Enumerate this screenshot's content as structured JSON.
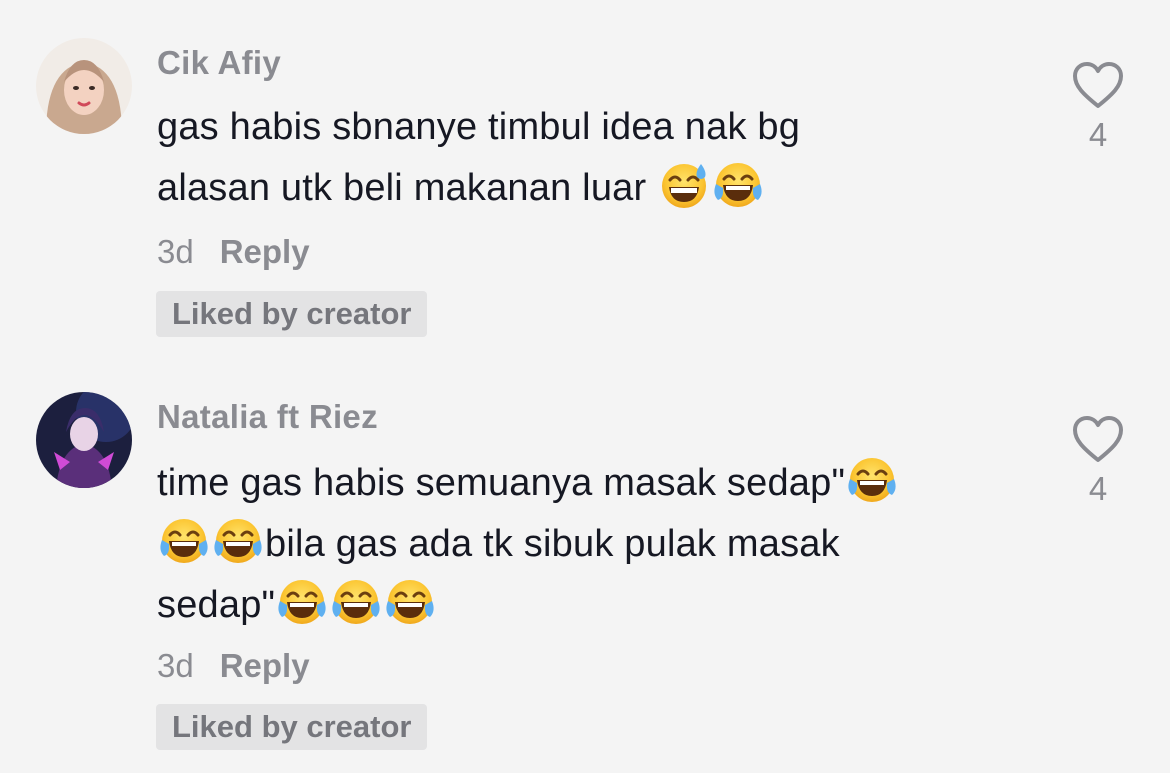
{
  "comments": [
    {
      "username": "Cik Afiy",
      "lines": [
        "gas habis sbnanye timbul idea nak bg",
        "alasan utk beli makanan luar "
      ],
      "time": "3d",
      "reply_label": "Reply",
      "badge": "Liked by creator",
      "like_count": "4"
    },
    {
      "username": "Natalia ft Riez",
      "lines": [
        "time gas habis semuanya masak sedap\"",
        "bila gas ada tk sibuk pulak masak",
        "sedap\""
      ],
      "time": "3d",
      "reply_label": "Reply",
      "badge": "Liked by creator",
      "like_count": "4"
    }
  ],
  "icons": {
    "like": "heart-outline-icon",
    "emoji_sweat": "grinning-sweat-emoji",
    "emoji_laugh": "tears-of-joy-emoji"
  },
  "colors": {
    "background": "#f4f4f4",
    "text": "#161823",
    "muted": "#8a8b91",
    "badge_bg": "#e3e3e4"
  }
}
